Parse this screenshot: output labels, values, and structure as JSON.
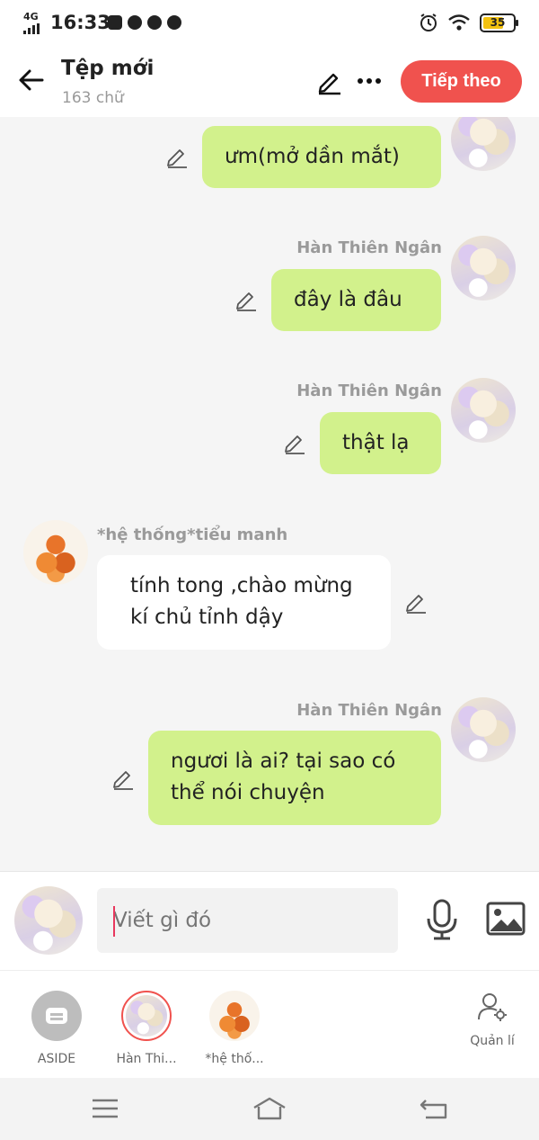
{
  "status_bar": {
    "network": "4G",
    "time": "16:33",
    "battery": "35",
    "icons": [
      "youtube-icon",
      "messenger-icon",
      "chrome-icon",
      "clock-app-icon",
      "alarm-icon",
      "wifi-icon",
      "battery-icon"
    ]
  },
  "header": {
    "title": "Tệp mới",
    "word_count": "163 chữ",
    "next_label": "Tiếp theo",
    "icons": [
      "back-arrow-icon",
      "pencil-icon",
      "more-dots-icon"
    ]
  },
  "messages": [
    {
      "side": "right",
      "sender": "",
      "text": "ưm(mở dần mắt)"
    },
    {
      "side": "right",
      "sender": "Hàn Thiên Ngân",
      "text": "đây là đâu"
    },
    {
      "side": "right",
      "sender": "Hàn Thiên Ngân",
      "text": "thật lạ"
    },
    {
      "side": "left",
      "sender": "*hệ thống*tiểu manh",
      "line1": "tính tong ,chào mừng",
      "line2": "kí chủ tỉnh dậy"
    },
    {
      "side": "right",
      "sender": "Hàn Thiên Ngân",
      "line1": "ngươi là ai? tại sao có",
      "line2": "thể nói chuyện"
    }
  ],
  "input": {
    "placeholder": "Viết gì đó",
    "icons": [
      "microphone-icon",
      "image-icon"
    ]
  },
  "characters": [
    {
      "label": "ASIDE"
    },
    {
      "label": "Hàn Thi..."
    },
    {
      "label": "*hệ thố..."
    }
  ],
  "manage_label": "Quản lí",
  "colors": {
    "accent": "#f0524e",
    "my_bubble": "#d2f18c",
    "their_bubble": "#ffffff",
    "background": "#f5f5f5"
  }
}
